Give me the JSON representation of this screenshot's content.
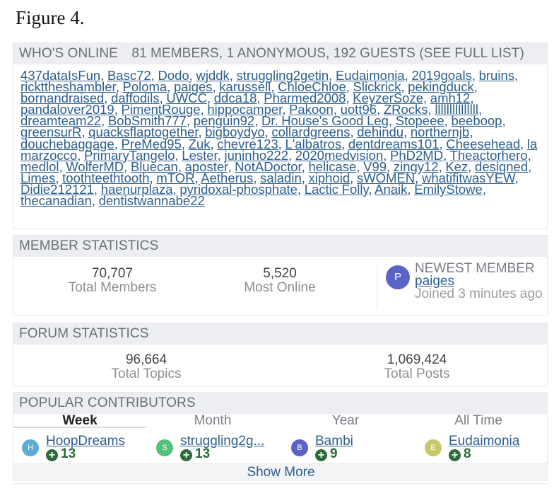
{
  "figure_title": "Figure 4.",
  "whos_online": {
    "title": "WHO'S ONLINE",
    "summary": "81 MEMBERS, 1 ANONYMOUS, 192 GUESTS",
    "full_list_link": "(SEE FULL LIST)",
    "members": [
      "437dataIsFun",
      "Basc72",
      "Dodo",
      "wjddk",
      "struggling2getin",
      "Eudaimonia",
      "2019goals",
      "bruins",
      "rickttheshambler",
      "Poloma",
      "paiges",
      "karussell",
      "ChloeChloe",
      "Slickrick",
      "pekingduck",
      "bornandraised",
      "daffodils",
      "UWCC",
      "ddca18",
      "Pharmed2008",
      "KeyzerSoze",
      "amh12",
      "pandalover2019",
      "PimentRouge",
      "hippocamper",
      "Pakoon",
      "uott96",
      "ZRocks",
      "lllllllllllllll",
      "dreamteam22",
      "BobSmith777",
      "penguin92",
      "Dr. House's Good Leg",
      "Stopeee",
      "beeboop",
      "greensurR",
      "quacksflaptogether",
      "bigboydyo",
      "collardgreens",
      "dehindu",
      "northernjb",
      "douchebaggage",
      "PreMed95",
      "Zuk",
      "chevre123",
      "L'albatros",
      "dentdreams101",
      "Cheesehead",
      "la marzocco",
      "PrimaryTangelo",
      "Lester",
      "juninho222",
      "2020medvision",
      "PhD2MD",
      "Theactorhero",
      "medlol",
      "WolferMD",
      "Bluecan",
      "aposter",
      "NotADoctor",
      "helicase",
      "V99",
      "zingy12",
      "Kez",
      "designed",
      "Limes",
      "toothteethtooth",
      "mTOR",
      "Aetherus",
      "saladin",
      "xiphoid",
      "sWOMEN",
      "whatifitwasYEW",
      "Didie212121",
      "haenurplaza",
      "pyridoxal-phosphate",
      "Lactic Folly",
      "Anaik",
      "EmilyStowe",
      "thecanadian",
      "dentistwannabe22"
    ]
  },
  "member_statistics": {
    "title": "MEMBER STATISTICS",
    "total_members": {
      "value": "70,707",
      "label": "Total Members"
    },
    "most_online": {
      "value": "5,520",
      "label": "Most Online"
    },
    "newest": {
      "heading": "NEWEST MEMBER",
      "name": "paiges",
      "avatar_letter": "P",
      "avatar_color": "#5c63c7",
      "joined": "Joined 3 minutes ago"
    }
  },
  "forum_statistics": {
    "title": "FORUM STATISTICS",
    "total_topics": {
      "value": "96,664",
      "label": "Total Topics"
    },
    "total_posts": {
      "value": "1,069,424",
      "label": "Total Posts"
    }
  },
  "popular_contributors": {
    "title": "POPULAR CONTRIBUTORS",
    "tabs": [
      "Week",
      "Month",
      "Year",
      "All Time"
    ],
    "active_tab": "Week",
    "contributors": [
      {
        "letter": "H",
        "name": "HoopDreams",
        "score": "13",
        "color": "#5aaed6"
      },
      {
        "letter": "S",
        "name": "struggling2g...",
        "score": "13",
        "color": "#55c07a"
      },
      {
        "letter": "B",
        "name": "Bambi",
        "score": "9",
        "color": "#5c63c7"
      },
      {
        "letter": "E",
        "name": "Eudaimonia",
        "score": "8",
        "color": "#c8c86a"
      }
    ],
    "show_more": "Show More"
  }
}
